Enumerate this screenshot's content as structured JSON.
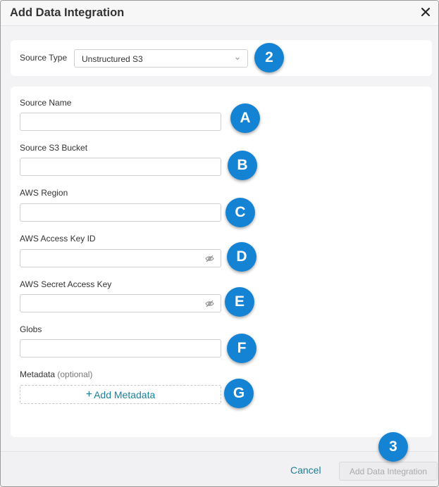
{
  "dialog": {
    "title": "Add Data Integration",
    "close_icon": "close-icon"
  },
  "source": {
    "label": "Source Type",
    "selected": "Unstructured S3",
    "caret_icon": "chevron-down-icon"
  },
  "fields": [
    {
      "label": "Source Name",
      "value": ""
    },
    {
      "label": "Source S3 Bucket",
      "value": ""
    },
    {
      "label": "AWS Region",
      "value": ""
    },
    {
      "label": "AWS Access Key ID",
      "value": "",
      "icon": "eye-off-icon"
    },
    {
      "label": "AWS Secret Access Key",
      "value": "",
      "icon": "eye-off-icon"
    },
    {
      "label": "Globs",
      "value": ""
    }
  ],
  "metadata": {
    "label": "Metadata",
    "optional": "(optional)",
    "add_label": "Add Metadata",
    "add_icon": "+"
  },
  "badges": [
    "2",
    "A",
    "B",
    "C",
    "D",
    "E",
    "F",
    "G",
    "3"
  ],
  "footer": {
    "cancel_label": "Cancel",
    "submit_label": "Add Data Integration"
  },
  "colors": {
    "accent": "#1c7f99",
    "badge": "#1583d4",
    "disabled_text": "#a9a9ad"
  }
}
